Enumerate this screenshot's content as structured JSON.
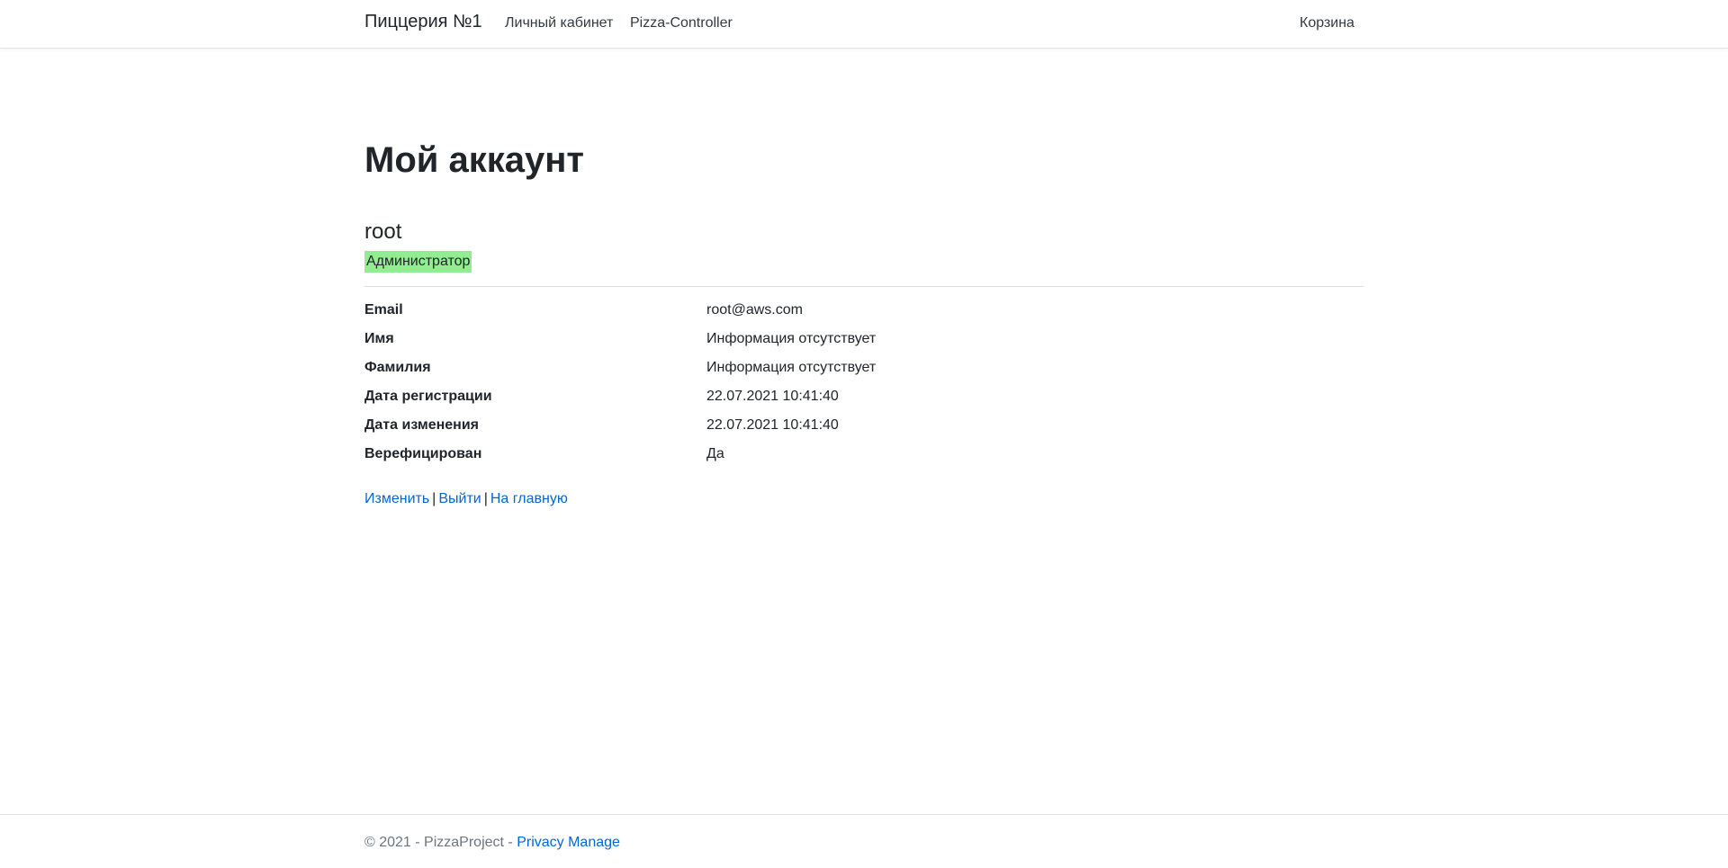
{
  "nav": {
    "brand": "Пиццерия №1",
    "links": [
      "Личный кабинет",
      "Pizza-Controller"
    ],
    "cart": "Корзина"
  },
  "page": {
    "title": "Мой аккаунт",
    "username": "root",
    "role": "Администратор",
    "role_color": "#90ee90"
  },
  "details": [
    {
      "label": "Email",
      "value": "root@aws.com"
    },
    {
      "label": "Имя",
      "value": "Информация отсутствует"
    },
    {
      "label": "Фамилия",
      "value": "Информация отсутствует"
    },
    {
      "label": "Дата регистрации",
      "value": "22.07.2021 10:41:40"
    },
    {
      "label": "Дата изменения",
      "value": "22.07.2021 10:41:40"
    },
    {
      "label": "Верефицирован",
      "value": "Да"
    }
  ],
  "actions": {
    "edit": "Изменить",
    "logout": "Выйти",
    "home": "На главную",
    "separator": "|"
  },
  "footer": {
    "copyright": "© 2021 - PizzaProject - ",
    "privacy": "Privacy Manage"
  },
  "colors": {
    "link": "#0366d6",
    "text": "#212529",
    "muted": "#6c757d"
  }
}
